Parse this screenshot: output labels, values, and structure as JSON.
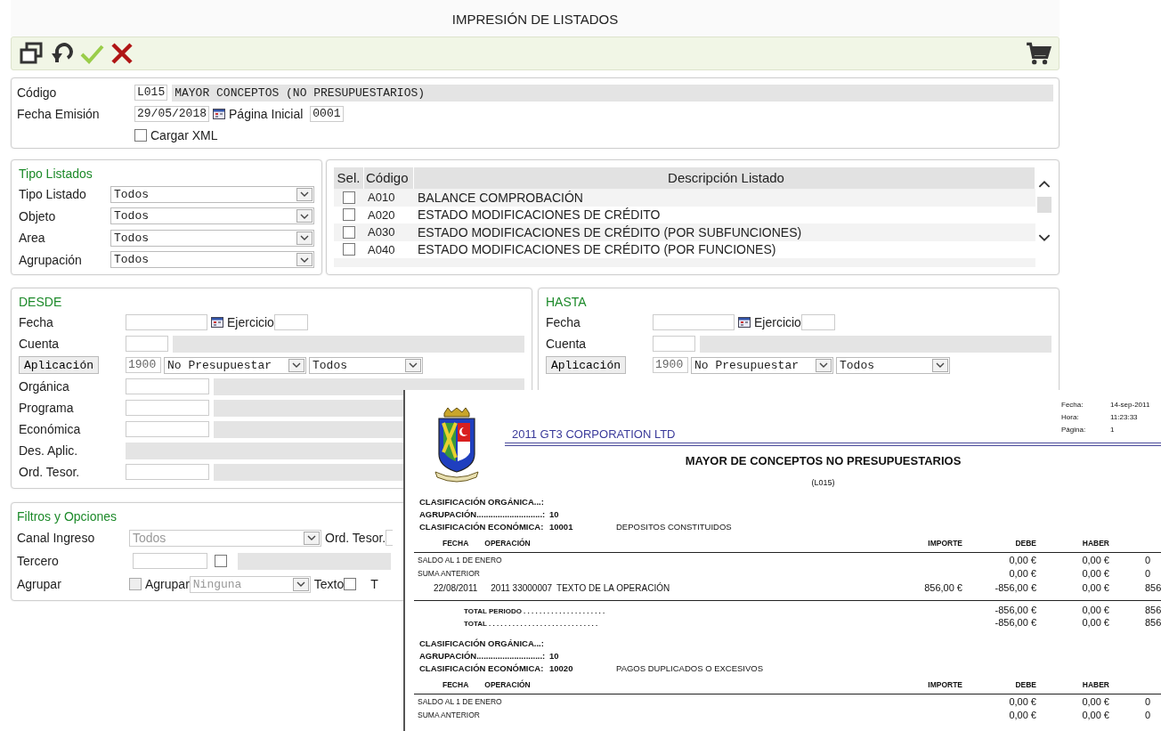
{
  "window": {
    "title": "IMPRESIÓN DE LISTADOS"
  },
  "toolbar": {
    "buttons": [
      {
        "kind": "windows"
      },
      {
        "kind": "undo"
      },
      {
        "kind": "accept"
      },
      {
        "kind": "cancel"
      },
      {
        "kind": "cart"
      }
    ]
  },
  "header": {
    "codigo_label": "Código",
    "codigo": "L015",
    "codigo_desc": "MAYOR CONCEPTOS (NO PRESUPUESTARIOS)",
    "fecha_label": "Fecha Emisión",
    "fecha": "29/05/2018",
    "pagina_label": "Página Inicial",
    "pagina": "0001",
    "xml": {
      "label": "Cargar XML",
      "checked": false
    }
  },
  "tipo_listados": {
    "title": "Tipo Listados",
    "fields": [
      {
        "label": "Tipo Listado",
        "value": "Todos"
      },
      {
        "label": "Objeto",
        "value": "Todos"
      },
      {
        "label": "Area",
        "value": "Todos"
      },
      {
        "label": "Agrupación",
        "value": "Todos"
      }
    ]
  },
  "listados": {
    "columns": [
      "Sel.",
      "Código",
      "Descripción Listado"
    ],
    "rows": [
      {
        "code": "A010",
        "description": "BALANCE COMPROBACIÓN",
        "checked": false
      },
      {
        "code": "A020",
        "description": "ESTADO MODIFICACIONES DE CRÉDITO",
        "checked": false
      },
      {
        "code": "A030",
        "description": "ESTADO MODIFICACIONES DE CRÉDITO (POR SUBFUNCIONES)",
        "checked": false
      },
      {
        "code": "A040",
        "description": "ESTADO MODIFICACIONES DE CRÉDITO (POR FUNCIONES)",
        "checked": false
      }
    ]
  },
  "desde": {
    "title": "DESDE",
    "rows": [
      {
        "kind": "date",
        "label": "Fecha",
        "extra_label": "Ejercicio"
      },
      {
        "kind": "lookup",
        "label": "Cuenta"
      },
      {
        "kind": "aplicacion",
        "button": "Aplicación",
        "year": "1900",
        "type": "No Presupuestar",
        "scope": "Todos"
      },
      {
        "kind": "lookup",
        "label": "Orgánica"
      },
      {
        "kind": "lookup",
        "label": "Programa"
      },
      {
        "kind": "lookup",
        "label": "Económica"
      },
      {
        "kind": "desc",
        "label": "Des. Aplic."
      },
      {
        "kind": "lookup",
        "label": "Ord. Tesor."
      }
    ]
  },
  "hasta": {
    "title": "HASTA",
    "rows": [
      {
        "kind": "date",
        "label": "Fecha",
        "extra_label": "Ejercicio"
      },
      {
        "kind": "lookup",
        "label": "Cuenta"
      },
      {
        "kind": "aplicacion",
        "button": "Aplicación",
        "year": "1900",
        "type": "No Presupuestar",
        "scope": "Todos"
      }
    ]
  },
  "filtros": {
    "title": "Filtros y Opciones",
    "canal_label": "Canal Ingreso",
    "canal": {
      "value": "Todos",
      "disabled": true
    },
    "ord_label": "Ord. Tesor.",
    "tercero_label": "Tercero",
    "tercero_checked": false,
    "agrupar_label": "Agrupar",
    "agrupar_checked": false,
    "agrupar_select_label": "Agrupar",
    "agrupar_select": {
      "value": "Ninguna",
      "disabled": true
    },
    "texto_label": "Texto",
    "texto_checked": false,
    "cut_label": "T"
  },
  "report": {
    "company": "2011 GT3 CORPORATION LTD",
    "meta": [
      {
        "label": "Fecha:",
        "value": "14-sep-2011"
      },
      {
        "label": "Hora:",
        "value": "11:23:33"
      },
      {
        "label": "Página:",
        "value": "1"
      }
    ],
    "title": "MAYOR DE CONCEPTOS NO PRESUPUESTARIOS",
    "code": "(L015)",
    "sections": [
      {
        "organica_label": "CLASIFICACIÓN ORGÁNICA...:",
        "agrupacion_label": "AGRUPACIÓN............................:",
        "agrupacion": "10",
        "economica_label": "CLASIFICACIÓN ECONÓMICA:",
        "economica": "10001",
        "economica_desc": "DEPOSITOS CONSTITUIDOS",
        "columns": [
          "FECHA",
          "OPERACIÓN",
          "IMPORTE",
          "DEBE",
          "HABER"
        ],
        "lines": [
          {
            "kind": "label",
            "text": "SALDO AL 1 DE ENERO",
            "debe": "0,00 €",
            "haber": "0,00 €",
            "saldo": "0"
          },
          {
            "kind": "label",
            "text": "SUMA ANTERIOR",
            "debe": "0,00 €",
            "haber": "0,00 €",
            "saldo": "0"
          },
          {
            "kind": "operation",
            "fecha": "22/08/2011",
            "operacion": "2011 33000007",
            "text": "TEXTO DE LA OPERACIÓN",
            "importe": "856,00 €",
            "debe": "-856,00 €",
            "haber": "0,00 €",
            "saldo": "856"
          },
          {
            "kind": "total",
            "text": "TOTAL PERIODO . . . . . . . . . . . . . . . . . . . . .",
            "debe": "-856,00 €",
            "haber": "0,00 €",
            "saldo": "856"
          },
          {
            "kind": "total",
            "text": "TOTAL . . . . . . . . . . . . . . . . . . . . . . . . . . . .",
            "debe": "-856,00 €",
            "haber": "0,00 €",
            "saldo": "856"
          }
        ]
      },
      {
        "organica_label": "CLASIFICACIÓN ORGÁNICA...:",
        "agrupacion_label": "AGRUPACIÓN............................:",
        "agrupacion": "10",
        "economica_label": "CLASIFICACIÓN ECONÓMICA:",
        "economica": "10020",
        "economica_desc": "PAGOS DUPLICADOS O EXCESIVOS",
        "columns": [
          "FECHA",
          "OPERACIÓN",
          "IMPORTE",
          "DEBE",
          "HABER"
        ],
        "lines": [
          {
            "kind": "label",
            "text": "SALDO AL 1 DE ENERO",
            "debe": "0,00 €",
            "haber": "0,00 €",
            "saldo": "0"
          },
          {
            "kind": "label",
            "text": "SUMA ANTERIOR",
            "debe": "0,00 €",
            "haber": "0,00 €",
            "saldo": "0"
          }
        ]
      }
    ]
  }
}
